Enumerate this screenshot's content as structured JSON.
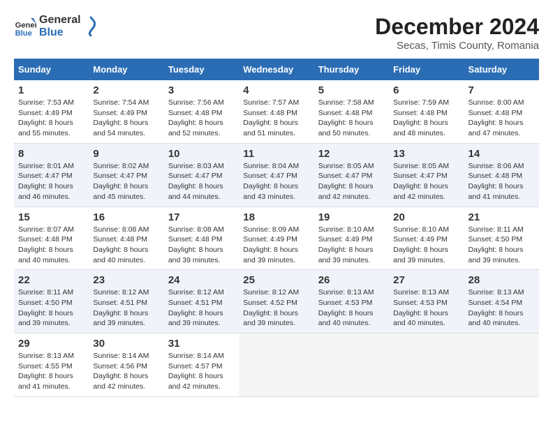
{
  "logo": {
    "line1": "General",
    "line2": "Blue"
  },
  "title": "December 2024",
  "subtitle": "Secas, Timis County, Romania",
  "days_of_week": [
    "Sunday",
    "Monday",
    "Tuesday",
    "Wednesday",
    "Thursday",
    "Friday",
    "Saturday"
  ],
  "weeks": [
    [
      {
        "day": "1",
        "sunrise": "7:53 AM",
        "sunset": "4:49 PM",
        "daylight": "8 hours and 55 minutes."
      },
      {
        "day": "2",
        "sunrise": "7:54 AM",
        "sunset": "4:49 PM",
        "daylight": "8 hours and 54 minutes."
      },
      {
        "day": "3",
        "sunrise": "7:56 AM",
        "sunset": "4:48 PM",
        "daylight": "8 hours and 52 minutes."
      },
      {
        "day": "4",
        "sunrise": "7:57 AM",
        "sunset": "4:48 PM",
        "daylight": "8 hours and 51 minutes."
      },
      {
        "day": "5",
        "sunrise": "7:58 AM",
        "sunset": "4:48 PM",
        "daylight": "8 hours and 50 minutes."
      },
      {
        "day": "6",
        "sunrise": "7:59 AM",
        "sunset": "4:48 PM",
        "daylight": "8 hours and 48 minutes."
      },
      {
        "day": "7",
        "sunrise": "8:00 AM",
        "sunset": "4:48 PM",
        "daylight": "8 hours and 47 minutes."
      }
    ],
    [
      {
        "day": "8",
        "sunrise": "8:01 AM",
        "sunset": "4:47 PM",
        "daylight": "8 hours and 46 minutes."
      },
      {
        "day": "9",
        "sunrise": "8:02 AM",
        "sunset": "4:47 PM",
        "daylight": "8 hours and 45 minutes."
      },
      {
        "day": "10",
        "sunrise": "8:03 AM",
        "sunset": "4:47 PM",
        "daylight": "8 hours and 44 minutes."
      },
      {
        "day": "11",
        "sunrise": "8:04 AM",
        "sunset": "4:47 PM",
        "daylight": "8 hours and 43 minutes."
      },
      {
        "day": "12",
        "sunrise": "8:05 AM",
        "sunset": "4:47 PM",
        "daylight": "8 hours and 42 minutes."
      },
      {
        "day": "13",
        "sunrise": "8:05 AM",
        "sunset": "4:47 PM",
        "daylight": "8 hours and 42 minutes."
      },
      {
        "day": "14",
        "sunrise": "8:06 AM",
        "sunset": "4:48 PM",
        "daylight": "8 hours and 41 minutes."
      }
    ],
    [
      {
        "day": "15",
        "sunrise": "8:07 AM",
        "sunset": "4:48 PM",
        "daylight": "8 hours and 40 minutes."
      },
      {
        "day": "16",
        "sunrise": "8:08 AM",
        "sunset": "4:48 PM",
        "daylight": "8 hours and 40 minutes."
      },
      {
        "day": "17",
        "sunrise": "8:08 AM",
        "sunset": "4:48 PM",
        "daylight": "8 hours and 39 minutes."
      },
      {
        "day": "18",
        "sunrise": "8:09 AM",
        "sunset": "4:49 PM",
        "daylight": "8 hours and 39 minutes."
      },
      {
        "day": "19",
        "sunrise": "8:10 AM",
        "sunset": "4:49 PM",
        "daylight": "8 hours and 39 minutes."
      },
      {
        "day": "20",
        "sunrise": "8:10 AM",
        "sunset": "4:49 PM",
        "daylight": "8 hours and 39 minutes."
      },
      {
        "day": "21",
        "sunrise": "8:11 AM",
        "sunset": "4:50 PM",
        "daylight": "8 hours and 39 minutes."
      }
    ],
    [
      {
        "day": "22",
        "sunrise": "8:11 AM",
        "sunset": "4:50 PM",
        "daylight": "8 hours and 39 minutes."
      },
      {
        "day": "23",
        "sunrise": "8:12 AM",
        "sunset": "4:51 PM",
        "daylight": "8 hours and 39 minutes."
      },
      {
        "day": "24",
        "sunrise": "8:12 AM",
        "sunset": "4:51 PM",
        "daylight": "8 hours and 39 minutes."
      },
      {
        "day": "25",
        "sunrise": "8:12 AM",
        "sunset": "4:52 PM",
        "daylight": "8 hours and 39 minutes."
      },
      {
        "day": "26",
        "sunrise": "8:13 AM",
        "sunset": "4:53 PM",
        "daylight": "8 hours and 40 minutes."
      },
      {
        "day": "27",
        "sunrise": "8:13 AM",
        "sunset": "4:53 PM",
        "daylight": "8 hours and 40 minutes."
      },
      {
        "day": "28",
        "sunrise": "8:13 AM",
        "sunset": "4:54 PM",
        "daylight": "8 hours and 40 minutes."
      }
    ],
    [
      {
        "day": "29",
        "sunrise": "8:13 AM",
        "sunset": "4:55 PM",
        "daylight": "8 hours and 41 minutes."
      },
      {
        "day": "30",
        "sunrise": "8:14 AM",
        "sunset": "4:56 PM",
        "daylight": "8 hours and 42 minutes."
      },
      {
        "day": "31",
        "sunrise": "8:14 AM",
        "sunset": "4:57 PM",
        "daylight": "8 hours and 42 minutes."
      },
      null,
      null,
      null,
      null
    ]
  ],
  "labels": {
    "sunrise": "Sunrise:",
    "sunset": "Sunset:",
    "daylight": "Daylight:"
  }
}
